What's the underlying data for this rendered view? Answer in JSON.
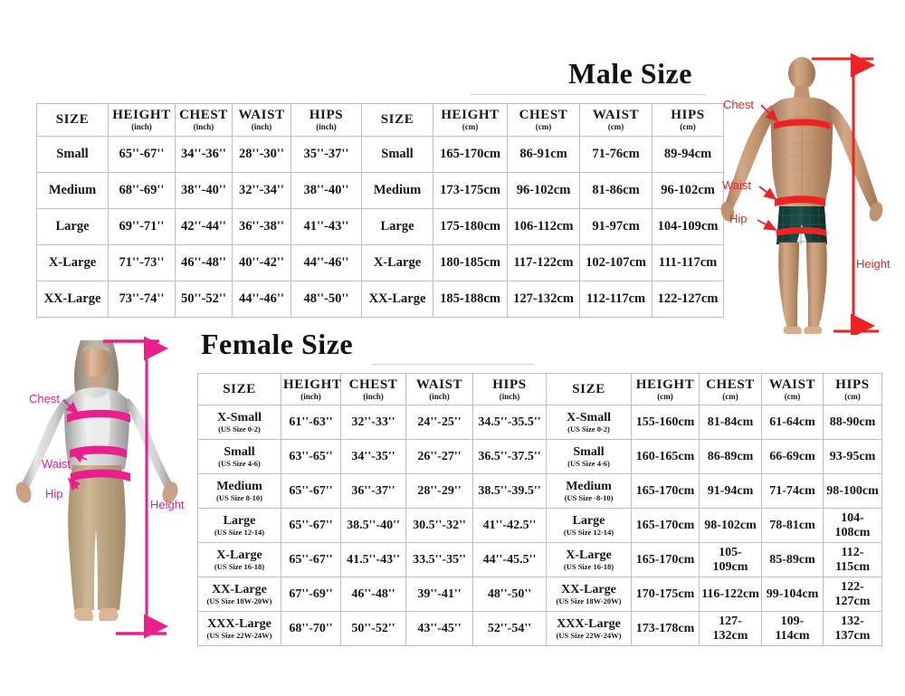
{
  "male": {
    "title": "Male Size",
    "headers_inch": [
      {
        "name": "SIZE",
        "unit": ""
      },
      {
        "name": "HEIGHT",
        "unit": "(inch)"
      },
      {
        "name": "CHEST",
        "unit": "(inch)"
      },
      {
        "name": "WAIST",
        "unit": "(inch)"
      },
      {
        "name": "HIPS",
        "unit": "(inch)"
      }
    ],
    "headers_cm": [
      {
        "name": "SIZE",
        "unit": ""
      },
      {
        "name": "HEIGHT",
        "unit": "(cm)"
      },
      {
        "name": "CHEST",
        "unit": "(cm)"
      },
      {
        "name": "WAIST",
        "unit": "(cm)"
      },
      {
        "name": "HIPS",
        "unit": "(cm)"
      }
    ],
    "rows": [
      {
        "size_inch": "Small",
        "height_inch": "65''-67''",
        "chest_inch": "34''-36''",
        "waist_inch": "28''-30''",
        "hips_inch": "35''-37''",
        "size_cm": "Small",
        "height_cm": "165-170cm",
        "chest_cm": "86-91cm",
        "waist_cm": "71-76cm",
        "hips_cm": "89-94cm"
      },
      {
        "size_inch": "Medium",
        "height_inch": "68''-69''",
        "chest_inch": "38''-40''",
        "waist_inch": "32''-34''",
        "hips_inch": "38''-40''",
        "size_cm": "Medium",
        "height_cm": "173-175cm",
        "chest_cm": "96-102cm",
        "waist_cm": "81-86cm",
        "hips_cm": "96-102cm"
      },
      {
        "size_inch": "Large",
        "height_inch": "69''-71''",
        "chest_inch": "42''-44''",
        "waist_inch": "36''-38''",
        "hips_inch": "41''-43''",
        "size_cm": "Large",
        "height_cm": "175-180cm",
        "chest_cm": "106-112cm",
        "waist_cm": "91-97cm",
        "hips_cm": "104-109cm"
      },
      {
        "size_inch": "X-Large",
        "height_inch": "71''-73''",
        "chest_inch": "46''-48''",
        "waist_inch": "40''-42''",
        "hips_inch": "44''-46''",
        "size_cm": "X-Large",
        "height_cm": "180-185cm",
        "chest_cm": "117-122cm",
        "waist_cm": "102-107cm",
        "hips_cm": "111-117cm"
      },
      {
        "size_inch": "XX-Large",
        "height_inch": "73''-74''",
        "chest_inch": "50''-52''",
        "waist_inch": "44''-46''",
        "hips_inch": "48''-50''",
        "size_cm": "XX-Large",
        "height_cm": "185-188cm",
        "chest_cm": "127-132cm",
        "waist_cm": "112-117cm",
        "hips_cm": "122-127cm"
      }
    ],
    "figure": {
      "labels": [
        "Chest",
        "Waist",
        "Hip",
        "Height"
      ],
      "accent_color": "#ee2222"
    }
  },
  "female": {
    "title": "Female Size",
    "headers_inch": [
      {
        "name": "SIZE",
        "unit": ""
      },
      {
        "name": "HEIGHT",
        "unit": "(inch)"
      },
      {
        "name": "CHEST",
        "unit": "(inch)"
      },
      {
        "name": "WAIST",
        "unit": "(inch)"
      },
      {
        "name": "HIPS",
        "unit": "(inch)"
      }
    ],
    "headers_cm": [
      {
        "name": "SIZE",
        "unit": ""
      },
      {
        "name": "HEIGHT",
        "unit": "(cm)"
      },
      {
        "name": "CHEST",
        "unit": "(cm)"
      },
      {
        "name": "WAIST",
        "unit": "(cm)"
      },
      {
        "name": "HIPS",
        "unit": "(cm)"
      }
    ],
    "rows": [
      {
        "size_inch": "X-Small",
        "us_inch": "(US Size 0-2)",
        "height_inch": "61''-63''",
        "chest_inch": "32''-33''",
        "waist_inch": "24''-25''",
        "hips_inch": "34.5''-35.5''",
        "size_cm": "X-Small",
        "us_cm": "(US Size 0-2)",
        "height_cm": "155-160cm",
        "chest_cm": "81-84cm",
        "waist_cm": "61-64cm",
        "hips_cm": "88-90cm"
      },
      {
        "size_inch": "Small",
        "us_inch": "(US Size 4-6)",
        "height_inch": "63''-65''",
        "chest_inch": "34''-35''",
        "waist_inch": "26''-27''",
        "hips_inch": "36.5''-37.5''",
        "size_cm": "Small",
        "us_cm": "(US Size 4-6)",
        "height_cm": "160-165cm",
        "chest_cm": "86-89cm",
        "waist_cm": "66-69cm",
        "hips_cm": "93-95cm"
      },
      {
        "size_inch": "Medium",
        "us_inch": "(US Size 8-10)",
        "height_inch": "65''-67''",
        "chest_inch": "36''-37''",
        "waist_inch": "28''-29''",
        "hips_inch": "38.5''-39.5''",
        "size_cm": "Medium",
        "us_cm": "(US Size -8-10)",
        "height_cm": "165-170cm",
        "chest_cm": "91-94cm",
        "waist_cm": "71-74cm",
        "hips_cm": "98-100cm"
      },
      {
        "size_inch": "Large",
        "us_inch": "(US Size 12-14)",
        "height_inch": "65''-67''",
        "chest_inch": "38.5''-40''",
        "waist_inch": "30.5''-32''",
        "hips_inch": "41''-42.5''",
        "size_cm": "Large",
        "us_cm": "(US Size 12-14)",
        "height_cm": "165-170cm",
        "chest_cm": "98-102cm",
        "waist_cm": "78-81cm",
        "hips_cm": "104-108cm"
      },
      {
        "size_inch": "X-Large",
        "us_inch": "(US Size 16-18)",
        "height_inch": "65''-67''",
        "chest_inch": "41.5''-43''",
        "waist_inch": "33.5''-35''",
        "hips_inch": "44''-45.5''",
        "size_cm": "X-Large",
        "us_cm": "(US Size 16-18)",
        "height_cm": "165-170cm",
        "chest_cm": "105-109cm",
        "waist_cm": "85-89cm",
        "hips_cm": "112-115cm"
      },
      {
        "size_inch": "XX-Large",
        "us_inch": "(US Size 18W-20W)",
        "height_inch": "67''-69''",
        "chest_inch": "46''-48''",
        "waist_inch": "39''-41''",
        "hips_inch": "48''-50''",
        "size_cm": "XX-Large",
        "us_cm": "(US Size 18W-20W)",
        "height_cm": "170-175cm",
        "chest_cm": "116-122cm",
        "waist_cm": "99-104cm",
        "hips_cm": "122-127cm"
      },
      {
        "size_inch": "XXX-Large",
        "us_inch": "(US Size 22W-24W)",
        "height_inch": "68''-70''",
        "chest_inch": "50''-52''",
        "waist_inch": "43''-45''",
        "hips_inch": "52''-54''",
        "size_cm": "XXX-Large",
        "us_cm": "(US Size 22W-24W)",
        "height_cm": "173-178cm",
        "chest_cm": "127-132cm",
        "waist_cm": "109-114cm",
        "hips_cm": "132-137cm"
      }
    ],
    "figure": {
      "labels": [
        "Chest",
        "Waist",
        "Hip",
        "Height"
      ],
      "accent_color": "#ee1d8e"
    }
  }
}
